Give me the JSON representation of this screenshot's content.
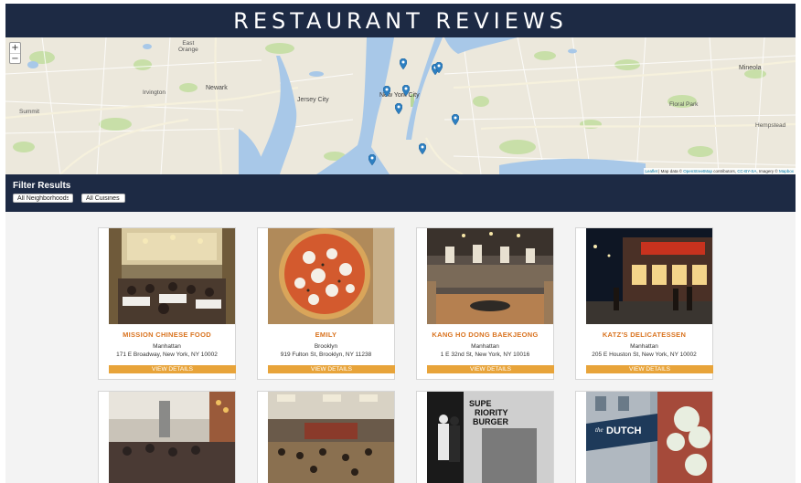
{
  "header": {
    "title": "RESTAURANT REVIEWS"
  },
  "map": {
    "zoom_in": "+",
    "zoom_out": "−",
    "attribution_leaflet": "Leaflet",
    "attribution_text": " | Map data © ",
    "attribution_osm": "OpenStreetMap",
    "attribution_rest": " contributors, ",
    "attribution_ccbysa": "CC-BY-SA",
    "attribution_imagery": ", Imagery © ",
    "attribution_mapbox": "Mapbox",
    "labels": {
      "east_orange": "East",
      "east_orange2": "Orange",
      "newark": "Newark",
      "irvington": "Irvington",
      "summit": "Summit",
      "jersey_city": "Jersey City",
      "new_york": "New York City",
      "floral_park": "Floral Park",
      "mineola": "Mineola",
      "hempstead": "Hempstead"
    },
    "marker_icon": "map-marker-icon",
    "marker_color": "#2d7fc1"
  },
  "filter": {
    "heading": "Filter Results",
    "neighborhood_selected": "All Neighborhoods",
    "cuisine_selected": "All Cuisines"
  },
  "restaurants": [
    {
      "name": "MISSION CHINESE FOOD",
      "neighborhood": "Manhattan",
      "address": "171 E Broadway, New York, NY 10002",
      "button": "VIEW DETAILS"
    },
    {
      "name": "EMILY",
      "neighborhood": "Brooklyn",
      "address": "919 Fulton St, Brooklyn, NY 11238",
      "button": "VIEW DETAILS"
    },
    {
      "name": "KANG HO DONG BAEKJEONG",
      "neighborhood": "Manhattan",
      "address": "1 E 32nd St, New York, NY 10016",
      "button": "VIEW DETAILS"
    },
    {
      "name": "KATZ'S DELICATESSEN",
      "neighborhood": "Manhattan",
      "address": "205 E Houston St, New York, NY 10002",
      "button": "VIEW DETAILS"
    }
  ],
  "photo_signs": {
    "superiority_1": "SUPE",
    "superiority_2": "RIORITY",
    "superiority_3": "BURGER",
    "dutch_the": "the",
    "dutch": "DUTCH"
  },
  "colors": {
    "header_bg": "#1d2a44",
    "accent_orange": "#d9731f",
    "button_bg": "#e8a43a"
  }
}
